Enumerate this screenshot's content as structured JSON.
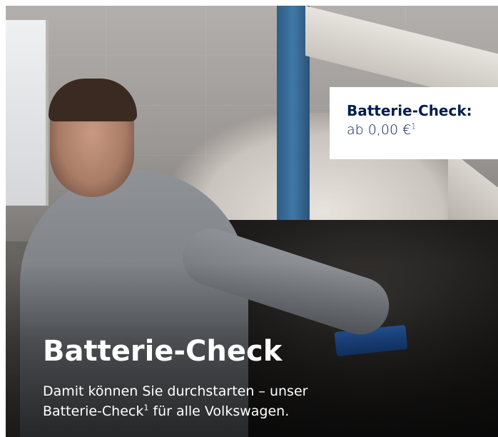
{
  "promo": {
    "image_alt_scene": "photo",
    "price_box": {
      "title": "Batterie-Check:",
      "value_prefix": "ab 0,00 €",
      "value_footnote": "1"
    },
    "headline": "Batterie-Check",
    "subtext": {
      "line1": "Damit können Sie durchstarten – unser",
      "line2_prefix": "Batterie-Check",
      "line2_footnote": "1",
      "line2_suffix": " für alle Volkswagen."
    },
    "colors": {
      "brand_navy": "#001e50",
      "text_on_image": "#ffffff"
    }
  }
}
